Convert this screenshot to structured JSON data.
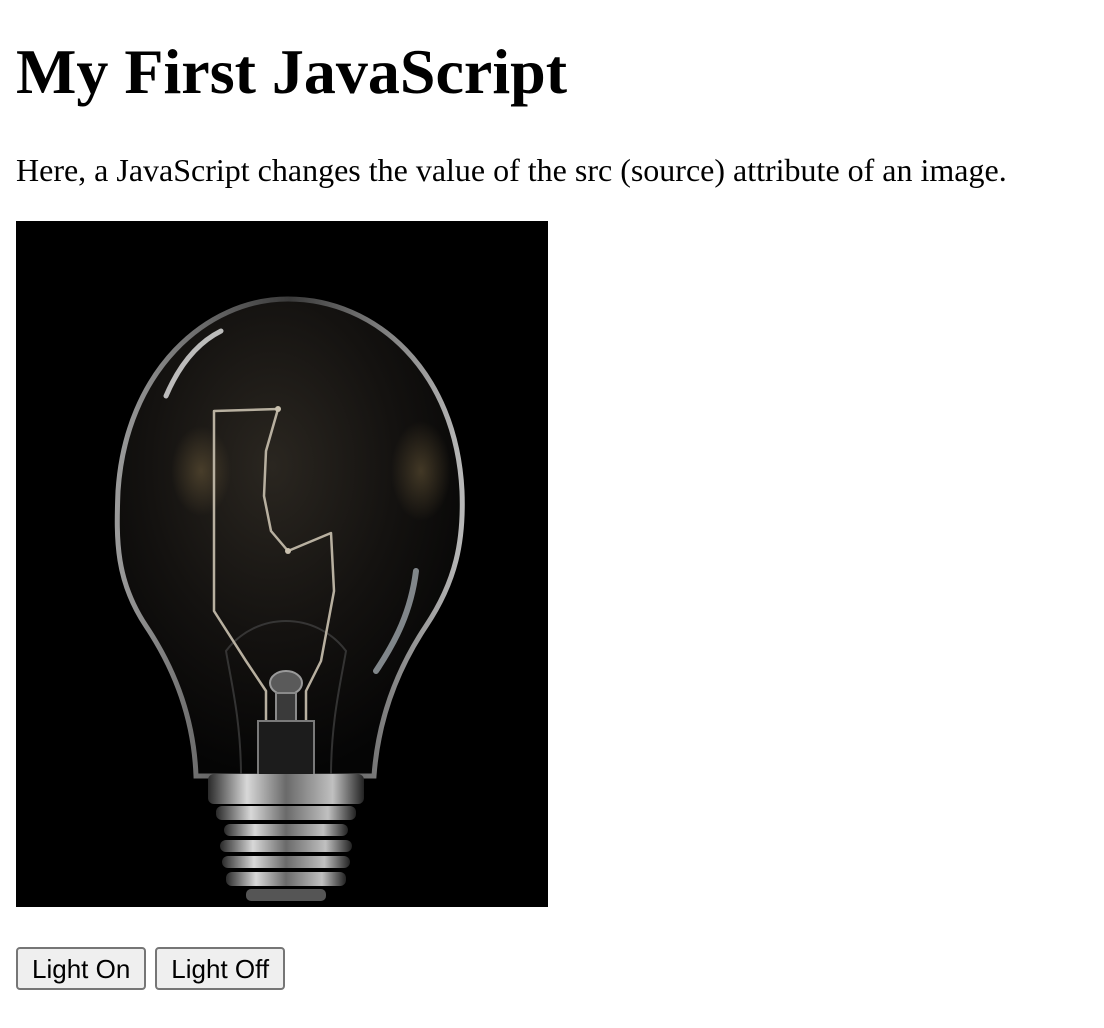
{
  "page": {
    "heading": "My First JavaScript",
    "description": "Here, a JavaScript changes the value of the src (source) attribute of an image."
  },
  "image": {
    "subject": "lightbulb-off",
    "background_color": "#000000"
  },
  "buttons": {
    "light_on_label": "Light On",
    "light_off_label": "Light Off"
  }
}
